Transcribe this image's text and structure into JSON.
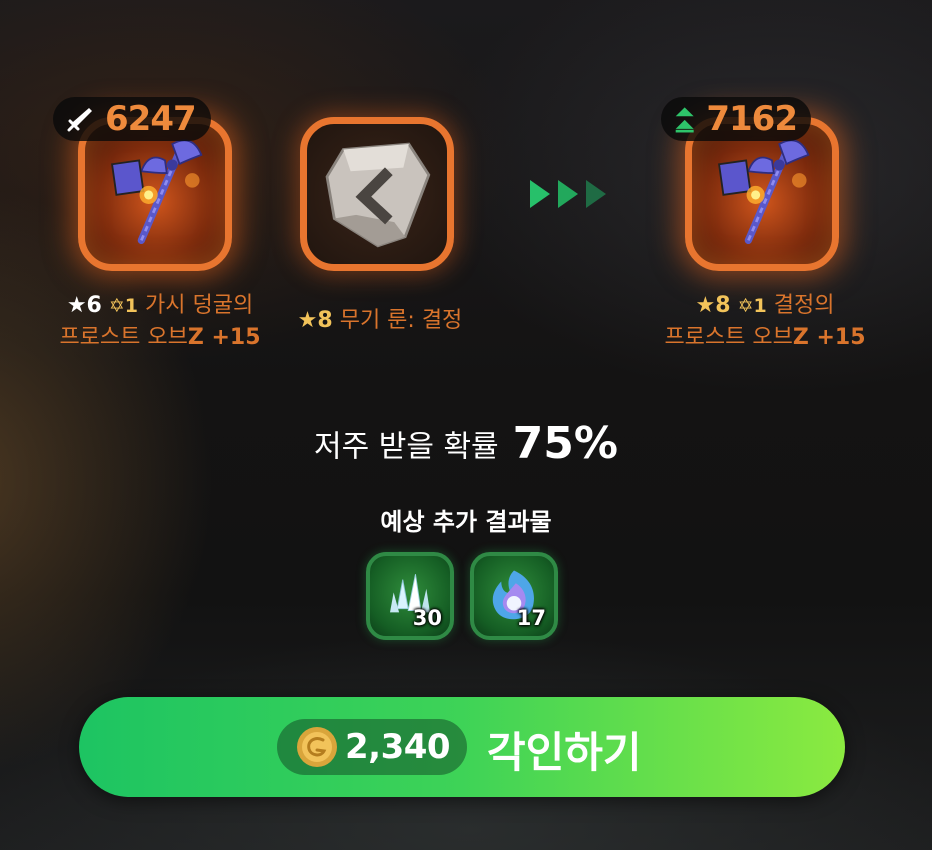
{
  "source_item": {
    "power": "6247",
    "power_icon": "sword-icon",
    "grade": "★6",
    "sub_grade": "✡1",
    "name_line1": "가시 덩굴의",
    "name_line2_main": "프로스트 오브",
    "name_line2_suffix": "Z +15"
  },
  "rune": {
    "grade": "★8",
    "name": "무기 룬: 결정",
    "icon": "rune-stone-icon"
  },
  "arrow_icon": "forward-arrows-icon",
  "result_item": {
    "power": "7162",
    "power_icon": "power-up-icon",
    "grade": "★8",
    "sub_grade": "✡1",
    "name_line1": "결정의",
    "name_line2_main": "프로스트 오브",
    "name_line2_suffix": "Z +15"
  },
  "curse": {
    "label": "저주 받을 확률",
    "percent": "75%"
  },
  "extra_results": {
    "title": "예상 추가 결과물",
    "items": [
      {
        "icon": "crystal-shards-icon",
        "qty": "30"
      },
      {
        "icon": "arcane-flame-icon",
        "qty": "17"
      }
    ]
  },
  "engrave_button": {
    "cost": "2,340",
    "currency_icon": "gold-coin-icon",
    "label": "각인하기"
  },
  "colors": {
    "accent_orange": "#e8752f",
    "button_green_start": "#1dc462",
    "button_green_end": "#8bea40",
    "grade_gold": "#f2c35a"
  }
}
